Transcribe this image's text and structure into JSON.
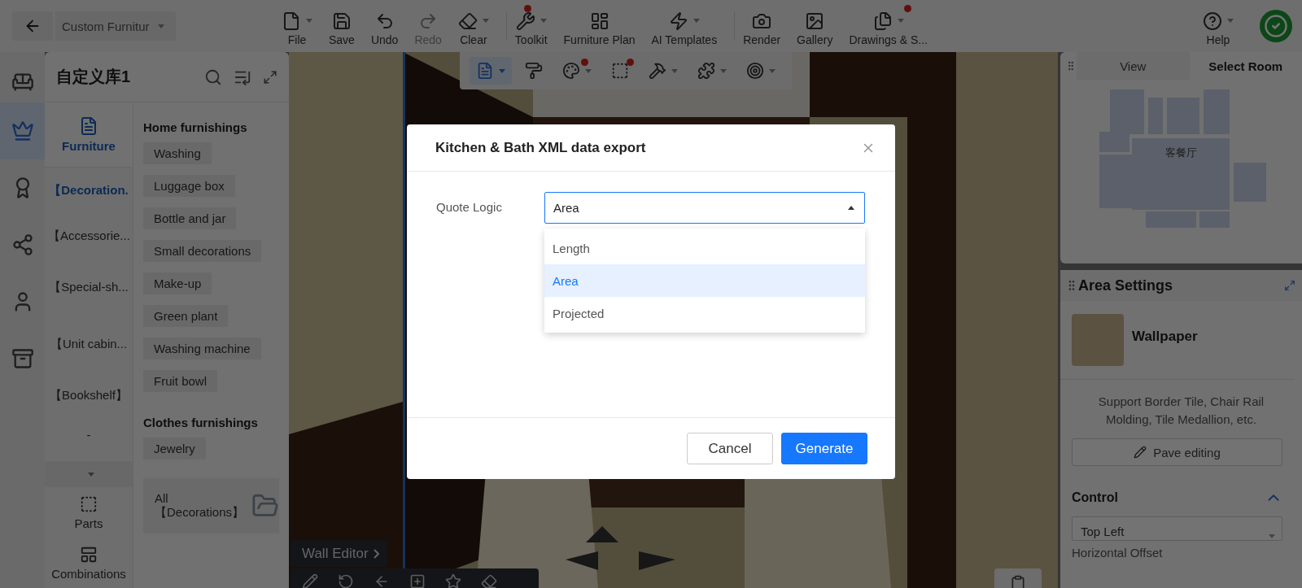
{
  "topbar": {
    "project": "Custom Furnitur",
    "tools": [
      {
        "kind": "file",
        "label": "File",
        "menu": true,
        "badge": false,
        "disabled": false,
        "divider": false
      },
      {
        "kind": "save",
        "label": "Save",
        "menu": false,
        "badge": false,
        "disabled": false,
        "divider": false
      },
      {
        "kind": "undo",
        "label": "Undo",
        "menu": false,
        "badge": false,
        "disabled": false,
        "divider": false
      },
      {
        "kind": "redo",
        "label": "Redo",
        "menu": false,
        "badge": false,
        "disabled": true,
        "divider": false
      },
      {
        "kind": "clear",
        "label": "Clear",
        "menu": true,
        "badge": false,
        "disabled": false,
        "divider": true
      },
      {
        "kind": "toolkit",
        "label": "Toolkit",
        "menu": true,
        "badge": true,
        "disabled": false,
        "divider": false
      },
      {
        "kind": "plan",
        "label": "Furniture Plan",
        "menu": false,
        "badge": false,
        "disabled": false,
        "divider": false
      },
      {
        "kind": "ai",
        "label": "AI Templates",
        "menu": true,
        "badge": false,
        "disabled": false,
        "divider": true
      },
      {
        "kind": "render",
        "label": "Render",
        "menu": false,
        "badge": false,
        "disabled": false,
        "divider": false
      },
      {
        "kind": "gallery",
        "label": "Gallery",
        "menu": false,
        "badge": false,
        "disabled": false,
        "divider": false
      },
      {
        "kind": "drawings",
        "label": "Drawings & S...",
        "menu": true,
        "badge": true,
        "disabled": false,
        "divider": false
      }
    ],
    "help": "Help"
  },
  "left_rail": [
    {
      "kind": "sofa",
      "selected": false
    },
    {
      "kind": "crown",
      "selected": true
    },
    {
      "kind": "badge",
      "selected": false
    },
    {
      "kind": "nodes",
      "selected": false
    },
    {
      "kind": "person",
      "selected": false
    },
    {
      "kind": "cabinet",
      "selected": false
    }
  ],
  "library": {
    "title": "自定义库1",
    "category_tab": {
      "label": "Furniture",
      "selected": true
    },
    "categories": [
      {
        "label": "【Decoration.",
        "selected": true
      },
      {
        "label": "【Accessorie...",
        "selected": false
      },
      {
        "label": "【Special-sh...",
        "selected": false
      },
      {
        "label": "【Unit cabin...",
        "selected": false
      },
      {
        "label": "【Bookshelf】",
        "selected": false
      },
      {
        "label": "-",
        "selected": false
      }
    ],
    "groups": [
      {
        "title": "Home furnishings",
        "items": [
          "Washing",
          "Luggage box",
          "Bottle and jar",
          "Small decorations",
          "Make-up",
          "Green plant",
          "Washing machine",
          "Fruit bowl"
        ]
      },
      {
        "title": "Clothes furnishings",
        "items": [
          "Jewelry"
        ]
      }
    ],
    "all_card": "All 【Decorations】",
    "bottom_tabs": [
      {
        "kind": "parts",
        "label": "Parts"
      },
      {
        "kind": "combinations",
        "label": "Combinations"
      }
    ]
  },
  "viewport": {
    "toolbar": [
      {
        "kind": "list",
        "selected": true,
        "badge": false,
        "menu": true
      },
      {
        "kind": "roller",
        "selected": false,
        "badge": false,
        "menu": false
      },
      {
        "kind": "palette",
        "selected": false,
        "badge": true,
        "menu": true
      },
      {
        "kind": "frame",
        "selected": false,
        "badge": true,
        "menu": false
      },
      {
        "kind": "hammer",
        "selected": false,
        "badge": false,
        "menu": true
      },
      {
        "kind": "puzzle",
        "selected": false,
        "badge": false,
        "menu": true
      },
      {
        "kind": "target",
        "selected": false,
        "badge": false,
        "menu": true
      }
    ],
    "wall_editor": "Wall Editor"
  },
  "right": {
    "tabs": [
      {
        "label": "View",
        "selected": false
      },
      {
        "label": "Select Room",
        "selected": true
      }
    ],
    "room_label": "客餐厅",
    "area_settings": {
      "title": "Area Settings",
      "material": "Wallpaper",
      "note": "Support Border Tile, Chair Rail Molding, Tile Medallion, etc.",
      "button": "Pave editing",
      "section": {
        "title": "Control",
        "expanded": true
      },
      "anchor": "Top Left",
      "offset_label": "Horizontal Offset"
    }
  },
  "dialog": {
    "title": "Kitchen & Bath XML data export",
    "field_label": "Quote Logic",
    "value": "Area",
    "open": true,
    "options": [
      {
        "label": "Length",
        "selected": false
      },
      {
        "label": "Area",
        "selected": true
      },
      {
        "label": "Projected",
        "selected": false
      }
    ],
    "buttons": [
      {
        "label": "Cancel",
        "kind": "default"
      },
      {
        "label": "Generate",
        "kind": "primary"
      }
    ]
  }
}
